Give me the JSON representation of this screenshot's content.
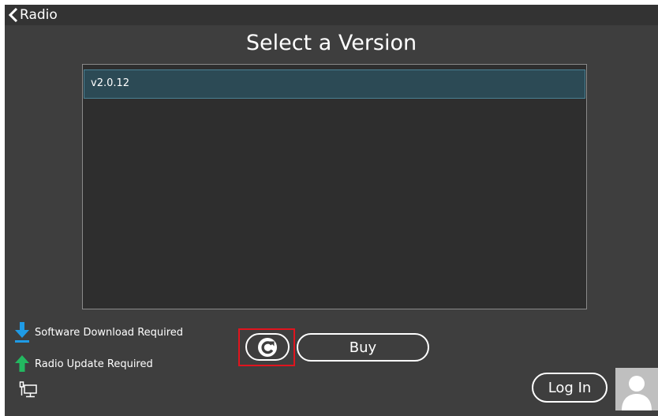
{
  "header": {
    "back_label": "Radio"
  },
  "page": {
    "title": "Select a Version"
  },
  "versions": [
    {
      "label": "v2.0.12",
      "selected": true
    }
  ],
  "legend": [
    {
      "icon": "download-arrow-icon",
      "label": "Software Download Required",
      "color": "#1f9be6"
    },
    {
      "icon": "up-arrow-icon",
      "label": "Radio Update Required",
      "color": "#23b860"
    }
  ],
  "buttons": {
    "buy_label": "Buy",
    "login_label": "Log In"
  },
  "colors": {
    "background": "#3e3e3e",
    "list_bg": "#2e2e2e",
    "selection": "#2c4a55",
    "highlight": "#e0141e"
  }
}
